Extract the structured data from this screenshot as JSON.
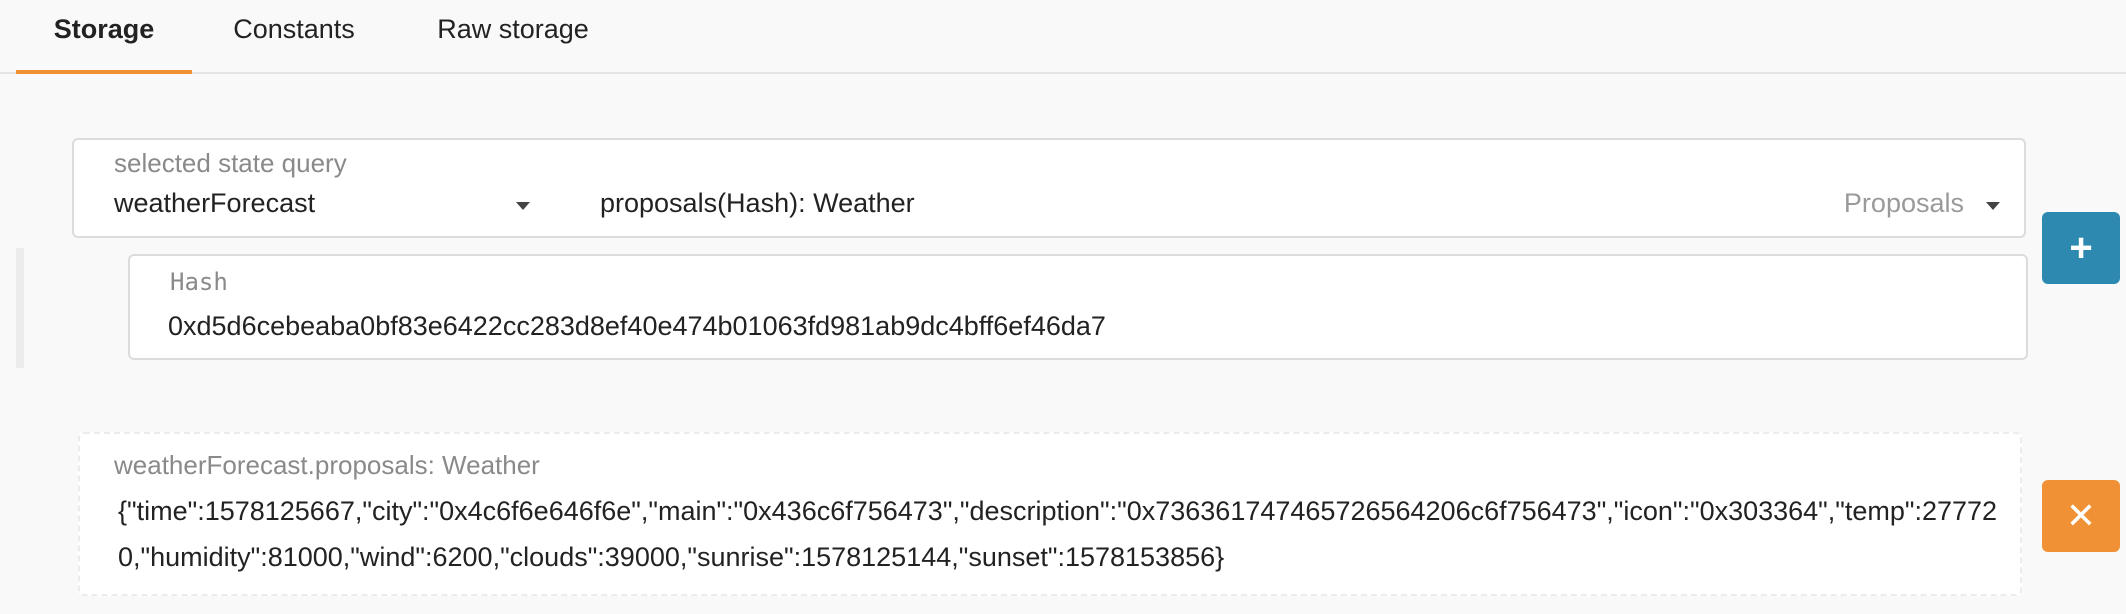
{
  "tabs": [
    {
      "label": "Storage",
      "active": true
    },
    {
      "label": "Constants",
      "active": false
    },
    {
      "label": "Raw storage",
      "active": false
    }
  ],
  "query": {
    "label": "selected state query",
    "module": "weatherForecast",
    "method": "proposals(Hash): Weather",
    "doc": "Proposals"
  },
  "param": {
    "label": "Hash",
    "value": "0xd5d6cebeaba0bf83e6422cc283d8ef40e474b01063fd981ab9dc4bff6ef46da7"
  },
  "buttons": {
    "add_glyph": "+",
    "remove_glyph": "✕"
  },
  "result": {
    "label": "weatherForecast.proposals: Weather",
    "value": "{\"time\":1578125667,\"city\":\"0x4c6f6e646f6e\",\"main\":\"0x436c6f756473\",\"description\":\"0x736361747465726564206c6f756473\",\"icon\":\"0x303364\",\"temp\":277720,\"humidity\":81000,\"wind\":6200,\"clouds\":39000,\"sunrise\":1578125144,\"sunset\":1578153856}"
  },
  "colors": {
    "accent_orange": "#f19135",
    "add_blue": "#2e89b0"
  }
}
